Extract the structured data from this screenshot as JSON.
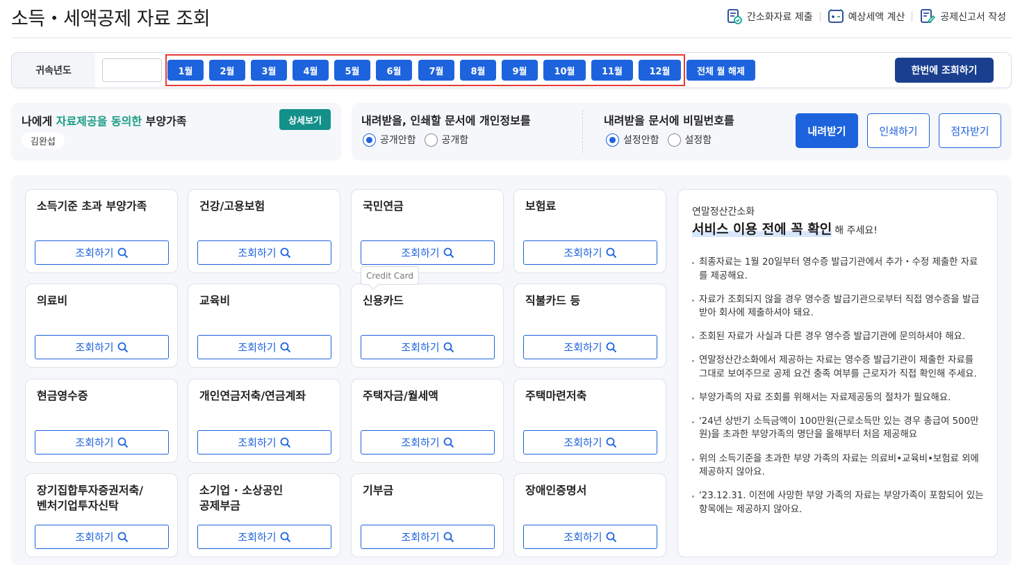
{
  "header": {
    "title": "소득・세액공제 자료 조회",
    "links": [
      {
        "label": "간소화자료 제출",
        "icon": "document-check-icon"
      },
      {
        "label": "예상세액 계산",
        "icon": "calculator-icon"
      },
      {
        "label": "공제신고서 작성",
        "icon": "document-edit-icon"
      }
    ]
  },
  "filter": {
    "year_label": "귀속년도",
    "year_value": "",
    "months": [
      "1월",
      "2월",
      "3월",
      "4월",
      "5월",
      "6월",
      "7월",
      "8월",
      "9월",
      "10월",
      "11월",
      "12월"
    ],
    "clear_all_label": "전체 월 해제",
    "query_all_label": "한번에 조회하기"
  },
  "dependents": {
    "title_pre": "나에게 ",
    "title_highlight": "자료제공을 동의한",
    "title_post": " 부양가족",
    "detail_button": "상세보기",
    "names": [
      "김완섭"
    ]
  },
  "options": {
    "privacy": {
      "title": "내려받을, 인쇄할 문서에 개인정보를",
      "choices": [
        "공개안함",
        "공개함"
      ],
      "selected": "공개안함"
    },
    "password": {
      "title": "내려받을 문서에 비밀번호를",
      "choices": [
        "설정안함",
        "설정함"
      ],
      "selected": "설정안함"
    },
    "download_label": "내려받기",
    "print_label": "인쇄하기",
    "braille_label": "점자받기"
  },
  "cards": [
    {
      "title": "소득기준 초과 부양가족"
    },
    {
      "title": "건강/고용보험"
    },
    {
      "title": "국민연금"
    },
    {
      "title": "보험료"
    },
    {
      "title": "의료비"
    },
    {
      "title": "교육비"
    },
    {
      "title": "신용카드"
    },
    {
      "title": "직불카드 등"
    },
    {
      "title": "현금영수증"
    },
    {
      "title": "개인연금저축/연금계좌"
    },
    {
      "title": "주택자금/월세액"
    },
    {
      "title": "주택마련저축"
    },
    {
      "title": "장기집합투자증권저축/\n벤처기업투자신탁"
    },
    {
      "title": "소기업 · 소상공인\n공제부금"
    },
    {
      "title": "기부금"
    },
    {
      "title": "장애인증명서"
    }
  ],
  "card_button_label": "조회하기",
  "tooltip": "Credit Card",
  "notice": {
    "subtitle": "연말정산간소화",
    "headline": "서비스 이용 전에 꼭 확인",
    "headline_tail": "해 주세요!",
    "items": [
      "최종자료는 1월 20일부터 영수증 발급기관에서 추가・수정 제출한 자료를 제공해요.",
      "자료가 조회되지 않을 경우 영수증 발급기관으로부터 직접 영수증을 발급받아 회사에 제출하셔야 돼요.",
      "조회된 자료가 사실과 다른 경우 영수증 발급기관에 문의하셔야 해요.",
      "연말정산간소화에서 제공하는 자료는 영수증 발급기관이 제출한 자료를 그대로 보여주므로 공제 요건 충족 여부를 근로자가 직접 확인해 주세요.",
      "부양가족의 자료 조회를 위해서는 자료제공동의 절차가 필요해요.",
      "'24년 상반기 소득금액이 100만원(근로소득만 있는 경우 총급여 500만원)을 초과한 부양가족의 명단을 올해부터 처음 제공해요",
      "위의 소득기준을 초과한 부양 가족의 자료는 의료비•교육비•보험료 외에 제공하지 않아요.",
      "'23.12.31. 이전에 사망한 부양 가족의 자료는 부양가족이 포함되어 있는 항목에는 제공하지 않아요."
    ]
  },
  "colors": {
    "primary": "#1d63dd",
    "navy": "#1a3f8f",
    "teal": "#14908a",
    "highlight_text": "#1a9c84",
    "month_group_border": "#e53935",
    "panel_bg": "#f5f7fa"
  }
}
